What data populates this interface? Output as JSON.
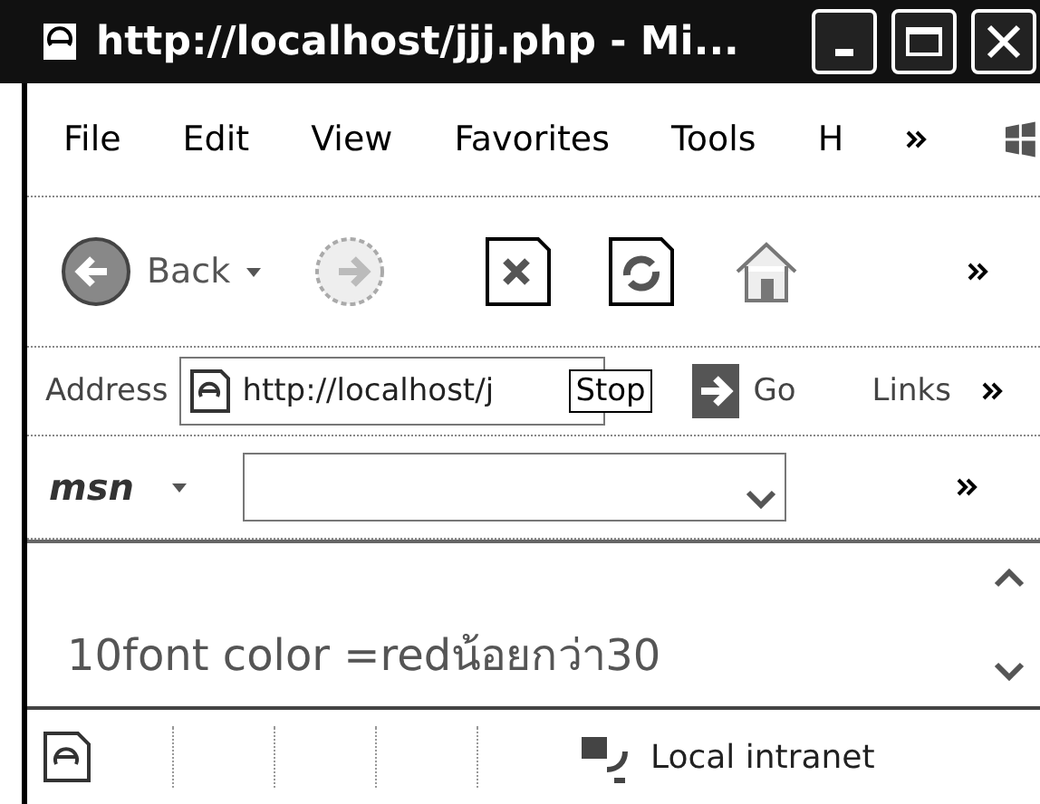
{
  "window": {
    "title": "http://localhost/jjj.php - Mi..."
  },
  "menu": [
    "File",
    "Edit",
    "View",
    "Favorites",
    "Tools",
    "H"
  ],
  "toolbar": {
    "back": "Back"
  },
  "address": {
    "label": "Address",
    "value": "http://localhost/j",
    "tooltip": "Stop",
    "go": "Go",
    "links": "Links"
  },
  "msn": {
    "logo": "msn"
  },
  "content": {
    "text": "10font color =redน้อยกว่า30"
  },
  "status_bar": {
    "zone": "Local intranet"
  }
}
